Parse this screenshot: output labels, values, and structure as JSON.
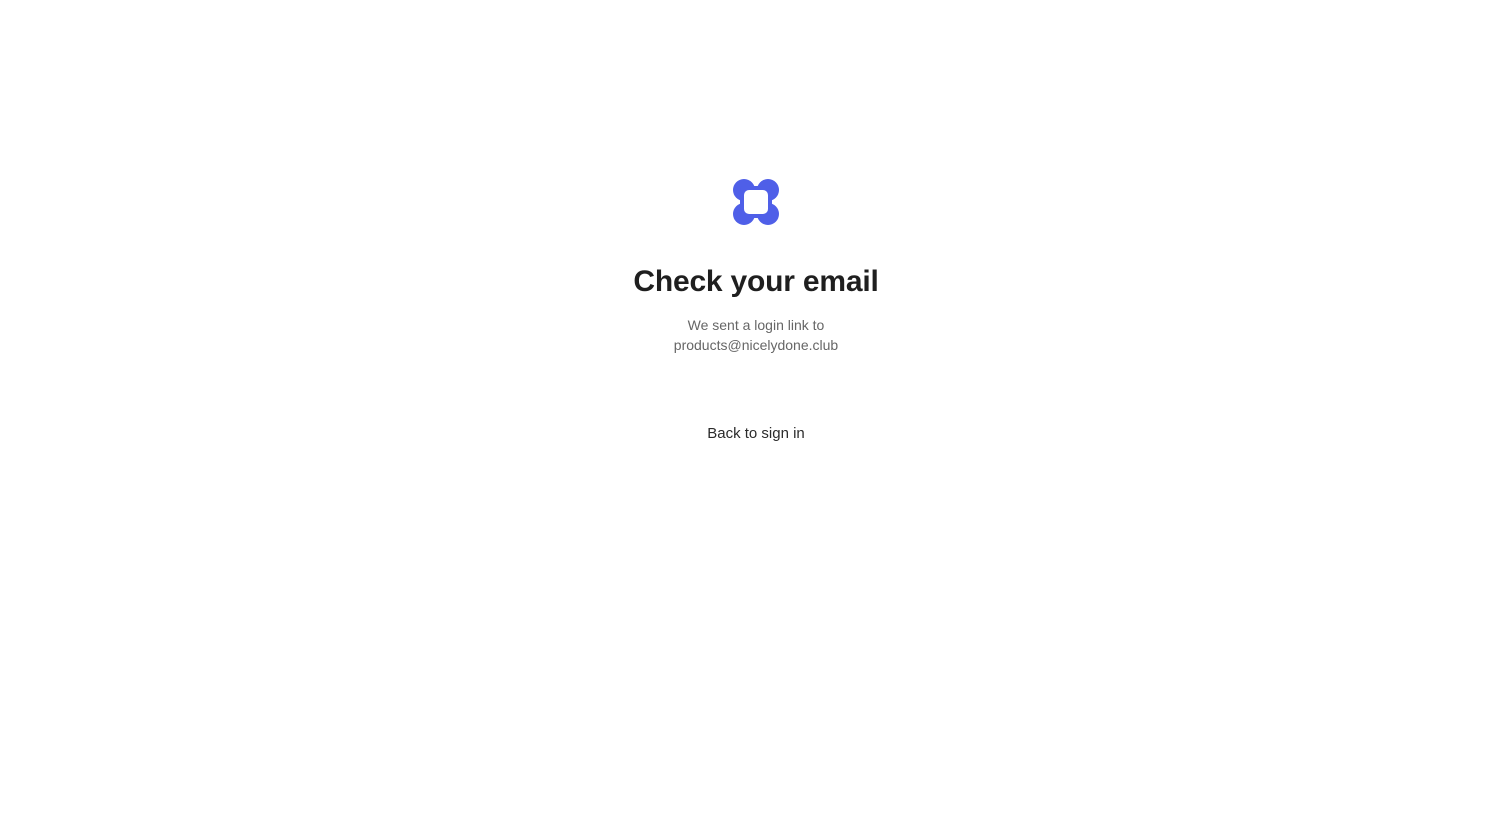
{
  "brand": {
    "logo_icon": "four-petal-logo-icon",
    "logo_color": "#4F5FE8"
  },
  "heading": {
    "title": "Check your email"
  },
  "message": {
    "line1": "We sent a login link to",
    "email": "products@nicelydone.club"
  },
  "actions": {
    "back_label": "Back to sign in"
  },
  "colors": {
    "title": "#1f1f1f",
    "subtitle": "#666666",
    "background": "#ffffff"
  }
}
